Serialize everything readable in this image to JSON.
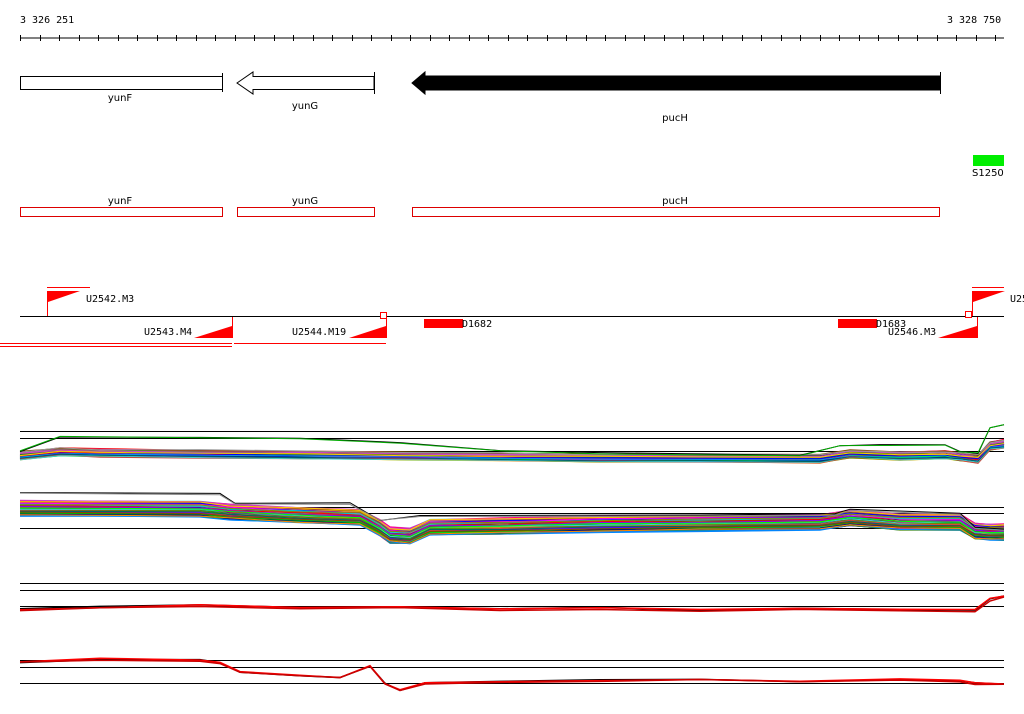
{
  "ruler": {
    "start_label": "3 326 251",
    "end_label": "3 328 750",
    "start": 3326251,
    "end": 3328750
  },
  "genes": [
    {
      "name": "yunF",
      "start": 3326251,
      "end": 3326765,
      "strand": "+",
      "fill": "#ffffff"
    },
    {
      "name": "yunG",
      "start": 3326790,
      "end": 3327150,
      "strand": "-",
      "fill": "#ffffff"
    },
    {
      "name": "pucH",
      "start": 3327245,
      "end": 3328588,
      "strand": "-",
      "fill": "#000000"
    }
  ],
  "annotation_genes": [
    {
      "name": "yunF",
      "start": 3326251,
      "end": 3326765
    },
    {
      "name": "yunG",
      "start": 3326790,
      "end": 3327150
    },
    {
      "name": "pucH",
      "start": 3327245,
      "end": 3328588
    }
  ],
  "green_feature": {
    "name": "S1250",
    "color": "#00ee00"
  },
  "transcription_units": [
    {
      "name": "U2542.M3",
      "strand": "+"
    },
    {
      "name": "U2543.M4",
      "strand": "-"
    },
    {
      "name": "U2544.M19",
      "strand": "-"
    },
    {
      "name": "U2546.M3",
      "strand": "-"
    },
    {
      "name": "U25",
      "strand": "+"
    }
  ],
  "downregulated_blocks": [
    {
      "name": "D1682"
    },
    {
      "name": "D1683"
    }
  ],
  "colors": {
    "gene_outline": "#000000",
    "annotation_outline": "#dd0000",
    "tu": "#ff0000",
    "green": "#00ee00"
  }
}
